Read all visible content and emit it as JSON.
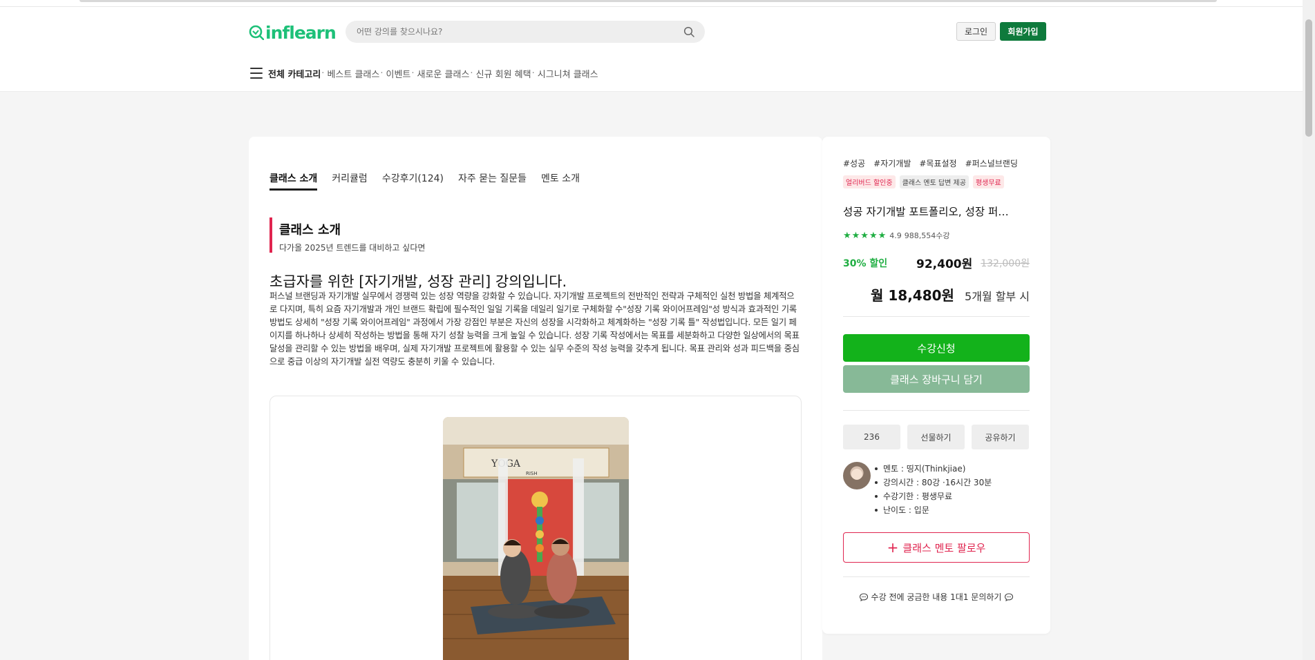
{
  "header": {
    "logo_text": "inflearn",
    "search": {
      "placeholder": "어떤 강의를 찾으시나요?"
    },
    "login_label": "로그인",
    "signup_label": "회원가입"
  },
  "nav": {
    "all_category": "전체 카테고리",
    "items": [
      "베스트 클래스",
      "이벤트",
      "새로운 클래스",
      "신규 회원 혜택",
      "시그니쳐 클래스"
    ],
    "separator": "·"
  },
  "main": {
    "tabs": [
      {
        "label": "클래스 소개",
        "active": true
      },
      {
        "label": "커리큘럼"
      },
      {
        "label": "수강후기(124)"
      },
      {
        "label": "자주 묻는 질문들"
      },
      {
        "label": "멘토 소개"
      }
    ],
    "intro_title": "클래스 소개",
    "intro_sub": "다가올 2025년 트렌드를 대비하고 싶다면",
    "headline": "초급자를 위한 [자기개발, 성장 관리] 강의입니다.",
    "description": "퍼스널 브랜딩과 자기개발 실무에서 경쟁력 있는 성장 역량을 강화할 수 있습니다. 자기개발 프로젝트의 전반적인 전략과 구체적인 실천 방법을 체계적으로 다지며, 특히 요즘 자기개발과 개인 브랜드 확립에 필수적인 일일 기록을 데일리 일기로 구체화할 수\"성장 기록 와이어프레임\"성 방식과 효과적인 기록 방법도 상세히 \"성장 기록 와이어프레임\" 과정에서 가장 강점인 부분은 자신의 성장을 시각화하고 체계화하는 \"성장 기록 틀\" 작성법입니다. 모든 일기 페이지를 하나하나 상세히 작성하는 방법을 통해 자기 성찰 능력을 크게 높일 수 있습니다. 성장 기록 작성에서는 목표를 세분화하고 다양한 일상에서의 목표 달성을 관리할 수 있는 방법을 배우며, 실제 자기개발 프로젝트에 활용할 수 있는 실무 수준의 작성 능력을 갖추게 됩니다. 목표 관리와 성과 피드백을 중심으로 중급 이상의 자기개발 실전 역량도 충분히 키울 수 있습니다.",
    "photo_banner_text": "YOGA",
    "photo_banner_sub": "RISH"
  },
  "sidebar": {
    "tags": [
      "#성공",
      "#자기개발",
      "#목표설정",
      "#퍼스널브랜딩"
    ],
    "badges": [
      {
        "label": "얼리버드 할인중",
        "style": "red"
      },
      {
        "label": "클래스 멘토 답변 제공",
        "style": "gray"
      },
      {
        "label": "평생무료",
        "style": "red"
      }
    ],
    "course_title": "성공 자기개발 포트폴리오, 성장 퍼…",
    "stars": "★★★★★",
    "rating": "4.9",
    "students": "988,554수강",
    "discount_label": "30% 할인",
    "price": "92,400원",
    "original_price": "132,000원",
    "monthly_price": "월 18,480원",
    "installment_label": "5개월 할부 시",
    "enroll_label": "수강신청",
    "cart_label": "클래스 장바구니 담기",
    "like_count": "236",
    "gift_label": "선물하기",
    "share_label": "공유하기",
    "info": [
      "멘토 : 띵지(Thinkjiae)",
      "강의시간 : 80강 ·16시간 30분",
      "수강기한 : 평생무료",
      "난이도 : 입문"
    ],
    "follow_label": "클래스 멘토 팔로우",
    "inquiry_label": "수강 전에 궁금한 내용 1대1 문의하기"
  },
  "colors": {
    "brand_green": "#1dc078",
    "signup_green": "#0e7a3c",
    "enroll_green": "#13b21b",
    "cart_green": "#87b997",
    "accent_red": "#e0244f"
  }
}
